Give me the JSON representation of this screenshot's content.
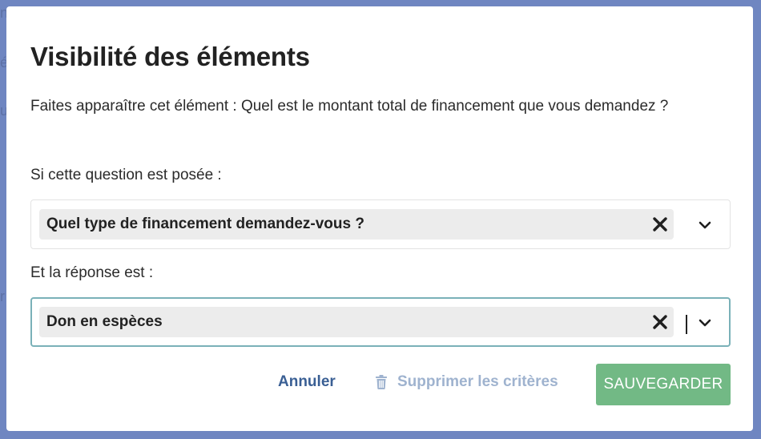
{
  "background": {
    "glimpses": [
      "n",
      "é",
      "u",
      "r"
    ]
  },
  "modal": {
    "title": "Visibilité des éléments",
    "description": "Faites apparaître cet élément : Quel est le montant total de financement que vous demandez ?",
    "question_label": "Si cette question est posée :",
    "question_select": {
      "selected": "Quel type de financement demandez-vous ?",
      "remove_icon": "close-icon",
      "dropdown_icon": "chevron-down-icon"
    },
    "answer_label": "Et la réponse est :",
    "answer_select": {
      "selected": "Don en espèces",
      "remove_icon": "close-icon",
      "dropdown_icon": "chevron-down-icon",
      "focused": true
    },
    "actions": {
      "cancel_label": "Annuler",
      "delete_label": "Supprimer les critères",
      "delete_icon": "trash-icon",
      "save_label": "SAUVEGARDER"
    }
  },
  "colors": {
    "overlay": "#6f86c1",
    "save_button": "#72b985",
    "cancel_text": "#3a5f94",
    "delete_text": "#9fb3cf",
    "focus_border": "#7ab1b8",
    "chip_bg": "#ececec"
  }
}
